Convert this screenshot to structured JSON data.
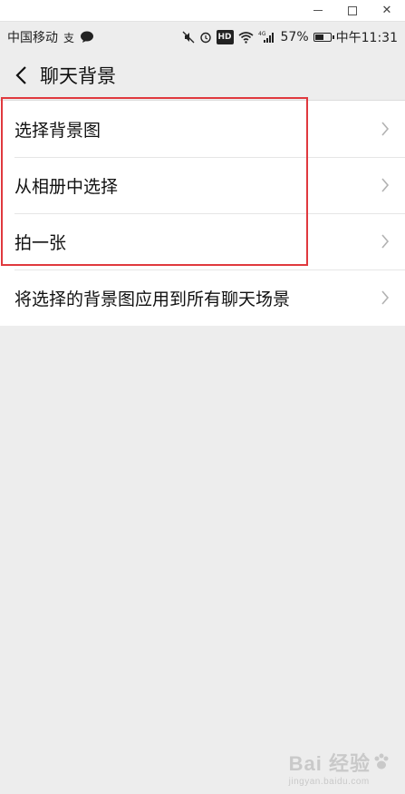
{
  "window": {
    "minimize_icon": "minimize-icon",
    "maximize_icon": "maximize-icon",
    "close_label": "✕"
  },
  "status_bar": {
    "carrier": "中国移动",
    "battery_percent": "57%",
    "battery_level": 0.57,
    "time": "中午11:31",
    "network": "4G",
    "hd_badge": "HD"
  },
  "nav": {
    "title": "聊天背景"
  },
  "menu": {
    "items": [
      {
        "label": "选择背景图"
      },
      {
        "label": "从相册中选择"
      },
      {
        "label": "拍一张"
      },
      {
        "label": "将选择的背景图应用到所有聊天场景"
      }
    ]
  },
  "watermark": {
    "main": "Bai 经验",
    "sub": "jingyan.baidu.com"
  },
  "colors": {
    "background": "#ededed",
    "highlight": "#e0393e",
    "list_bg": "#ffffff"
  }
}
